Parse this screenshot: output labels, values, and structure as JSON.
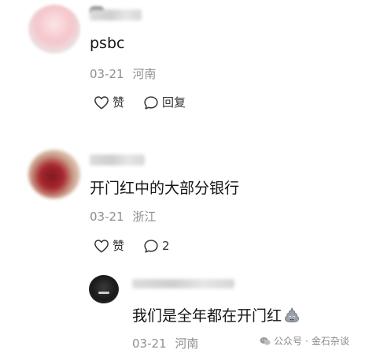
{
  "comments": [
    {
      "text": "psbc",
      "date": "03-21",
      "location": "河南",
      "like_label": "赞",
      "reply_label": "回复"
    },
    {
      "text": "开门红中的大部分银行",
      "date": "03-21",
      "location": "浙江",
      "like_label": "赞",
      "reply_count": "2"
    }
  ],
  "reply": {
    "text": "我们是全年都在开门红",
    "date": "03-21",
    "location": "河南",
    "emoji_icon": "poop-emoji-icon"
  },
  "watermark": {
    "source": "公众号",
    "separator": "·",
    "account": "金石杂谈"
  },
  "colors": {
    "text": "#151515",
    "meta": "#8f8f8f",
    "action": "#333333"
  }
}
